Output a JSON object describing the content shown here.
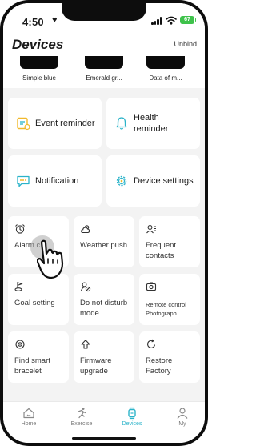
{
  "status_bar": {
    "time": "4:50",
    "battery": "67"
  },
  "header": {
    "title": "Devices",
    "unbind_label": "Unbind"
  },
  "dials": [
    {
      "name": "Simple blue"
    },
    {
      "name": "Emerald gr..."
    },
    {
      "name": "Data of m..."
    }
  ],
  "large_cards": [
    {
      "label": "Event reminder",
      "icon": "event-reminder-icon"
    },
    {
      "label": "Health reminder",
      "icon": "bell-icon"
    },
    {
      "label": "Notification",
      "icon": "notification-icon"
    },
    {
      "label": "Device settings",
      "icon": "gear-icon"
    }
  ],
  "small_cards": [
    {
      "label": "Alarm c...",
      "icon": "alarm-clock-icon"
    },
    {
      "label": "Weather push",
      "icon": "weather-icon"
    },
    {
      "label": "Frequent contacts",
      "icon": "contacts-icon"
    },
    {
      "label": "Goal setting",
      "icon": "goal-icon"
    },
    {
      "label": "Do not disturb mode",
      "icon": "do-not-disturb-icon"
    },
    {
      "label": "Remote control Photograph",
      "icon": "camera-icon"
    },
    {
      "label": "Find smart bracelet",
      "icon": "find-bracelet-icon"
    },
    {
      "label": "Firmware upgrade",
      "icon": "firmware-upgrade-icon"
    },
    {
      "label": "Restore Factory",
      "icon": "restore-icon"
    }
  ],
  "tabs": [
    {
      "label": "Home",
      "icon": "home-icon",
      "active": false
    },
    {
      "label": "Exercise",
      "icon": "running-icon",
      "active": false
    },
    {
      "label": "Devices",
      "icon": "watch-icon",
      "active": true
    },
    {
      "label": "My",
      "icon": "person-icon",
      "active": false
    }
  ],
  "colors": {
    "accent": "#2ab3c9",
    "background": "#f3f3f3",
    "battery": "#3ec24b"
  }
}
